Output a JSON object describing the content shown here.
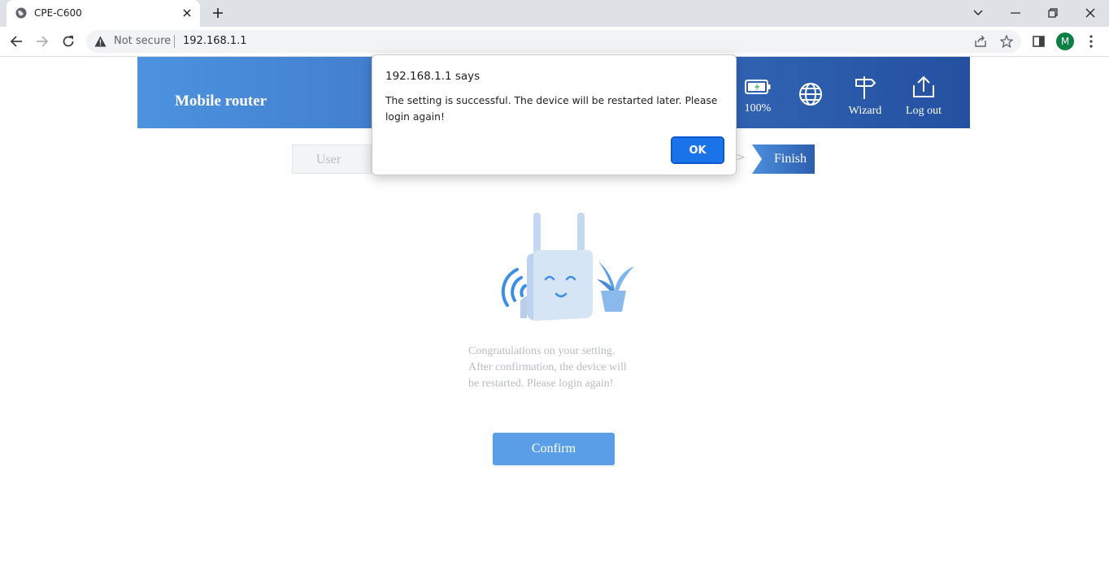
{
  "browser": {
    "tab_title": "CPE-C600",
    "security_label": "Not secure",
    "url": "192.168.1.1",
    "profile_initial": "M"
  },
  "header": {
    "brand": "Mobile router",
    "battery_percent": "100%",
    "wizard_label": "Wizard",
    "logout_label": "Log out"
  },
  "steps": {
    "user_label": "User",
    "arrow": ">",
    "finish_label": "Finish"
  },
  "message": {
    "line1": "Congratulations on your setting.",
    "line2": "After confirmation, the device will",
    "line3": "be restarted. Please login again!"
  },
  "confirm_label": "Confirm",
  "dialog": {
    "title": "192.168.1.1 says",
    "message": "The setting is successful. The device will be restarted later. Please login again!",
    "ok_label": "OK"
  },
  "colors": {
    "header_start": "#4c93df",
    "header_end": "#2450a0",
    "confirm_button": "#5a9ee7",
    "dialog_ok": "#1a73e8"
  }
}
